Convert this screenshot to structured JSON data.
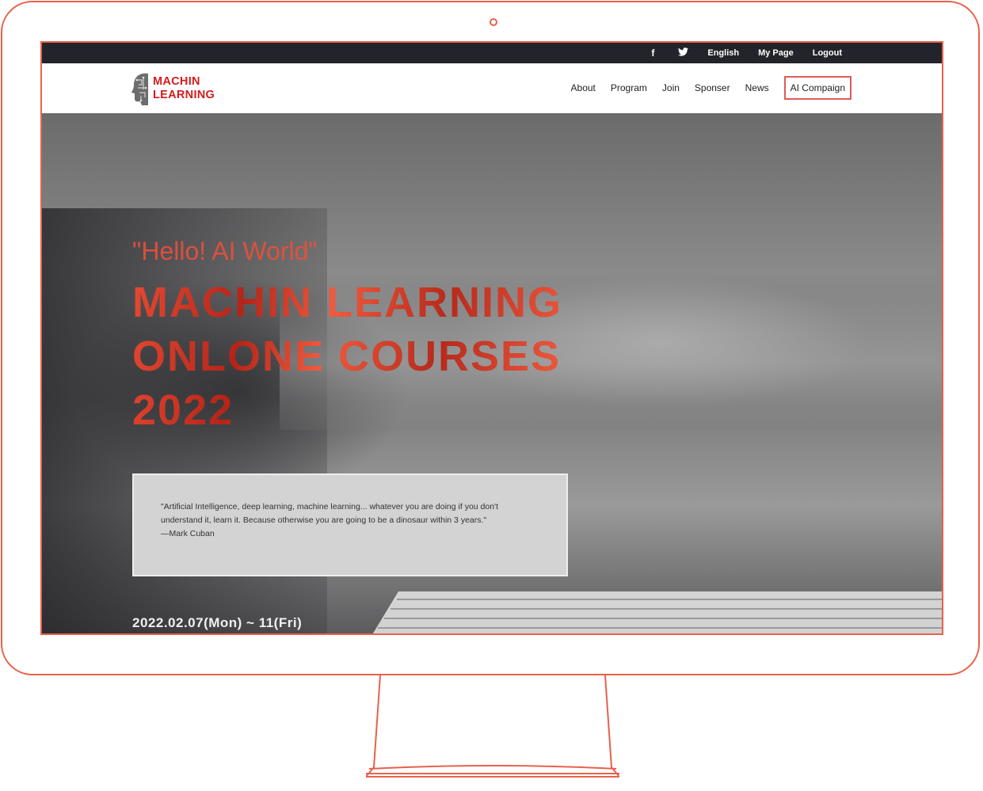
{
  "topbar": {
    "facebook_icon": "f",
    "twitter_icon": "🐦",
    "language": "English",
    "mypage": "My Page",
    "logout": "Logout"
  },
  "logo": {
    "line1": "MACHIN",
    "line2": "LEARNING"
  },
  "nav": {
    "items": [
      "About",
      "Program",
      "Join",
      "Sponser",
      "News"
    ],
    "campaign": "AI Compaign"
  },
  "hero": {
    "hello": "\"Hello! AI World\"",
    "headline": [
      "MACHIN LEARNING",
      "ONLONE COURSES",
      "2022"
    ],
    "quote": "\"Artificial Intelligence, deep learning, machine learning... whatever you are doing if you don't understand it, learn it. Because otherwise you are going to be a dinosaur within 3 years.\"",
    "quote_author": "—Mark Cuban",
    "dates": "2022.02.07(Mon) ~ 11(Fri)"
  },
  "colors": {
    "accent": "#e8614c",
    "brand_red": "#d41c1c",
    "topbar_bg": "#23242b"
  }
}
